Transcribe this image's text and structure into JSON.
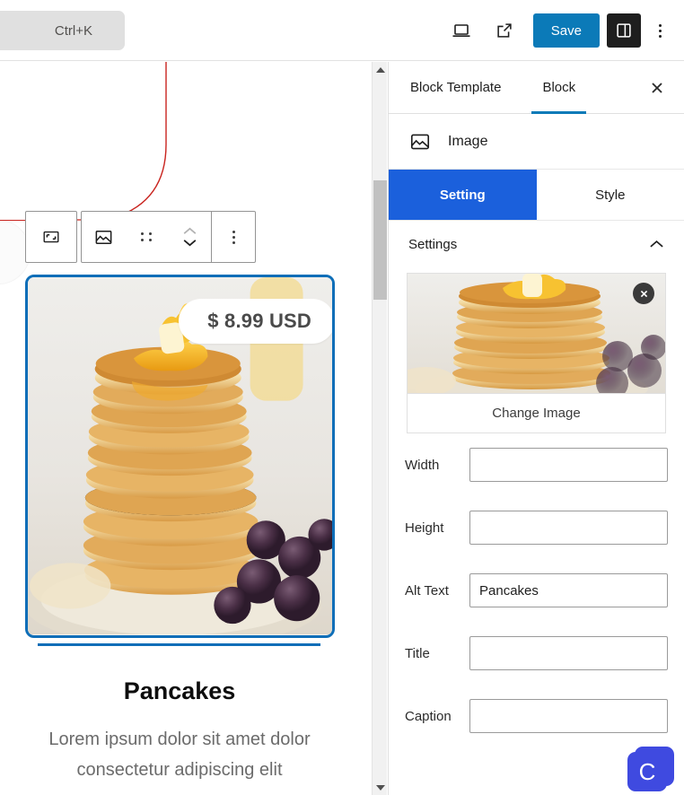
{
  "topbar": {
    "command_palette_shortcut": "Ctrl+K",
    "device_preview_icon": "laptop-icon",
    "open_external_icon": "external-link-icon",
    "save_label": "Save",
    "sidebar_toggle_icon": "sidebar-panel-icon",
    "more_menu_icon": "kebab-menu-icon"
  },
  "block_toolbar": {
    "select_parent_icon": "crop-frame-icon",
    "block_type_icon": "image-icon",
    "drag_handle_icon": "six-dots-drag-icon",
    "move_up_icon": "chevron-up-icon",
    "move_down_icon": "chevron-down-icon",
    "options_icon": "kebab-menu-icon"
  },
  "canvas": {
    "card": {
      "price_badge": "$ 8.99 USD",
      "image_alt": "Pancakes",
      "border_color": "#0e6eb8"
    },
    "product_title": "Pancakes",
    "product_description": "Lorem ipsum dolor sit amet dolor consectetur adipiscing elit",
    "scrollbar": {
      "up_arrow_icon": "triangle-up-icon",
      "down_arrow_icon": "triangle-down-icon"
    }
  },
  "panel": {
    "tabs": [
      {
        "label": "Block Template",
        "active": false
      },
      {
        "label": "Block",
        "active": true
      }
    ],
    "close_icon": "close-icon",
    "block": {
      "icon": "image-icon",
      "label": "Image"
    },
    "segments": [
      {
        "label": "Setting",
        "active": true
      },
      {
        "label": "Style",
        "active": false
      }
    ],
    "settings_section": {
      "title": "Settings",
      "collapse_icon": "chevron-up-icon"
    },
    "image_preview": {
      "remove_icon": "close-circle-icon",
      "change_label": "Change Image",
      "alt": "Pancakes"
    },
    "fields": [
      {
        "label": "Width",
        "value": "",
        "placeholder": ""
      },
      {
        "label": "Height",
        "value": "",
        "placeholder": ""
      },
      {
        "label": "Alt Text",
        "value": "Pancakes",
        "placeholder": ""
      },
      {
        "label": "Title",
        "value": "",
        "placeholder": ""
      },
      {
        "label": "Caption",
        "value": "",
        "placeholder": ""
      }
    ]
  },
  "floating_widget": {
    "label": "C"
  },
  "colors": {
    "save_blue": "#0b7ab8",
    "segment_blue": "#1b60dc",
    "card_blue": "#0e6eb8",
    "widget_indigo": "#3f4ae0",
    "annotation_red": "#c9241f"
  }
}
